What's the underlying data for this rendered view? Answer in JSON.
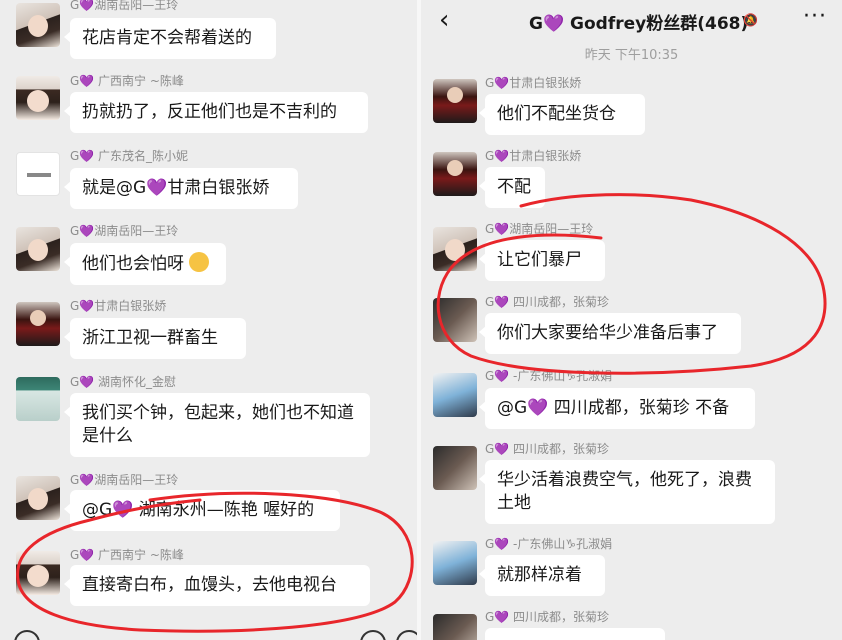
{
  "left": {
    "messages": [
      {
        "sender": "G💜湖南岳阳—王玲",
        "text": "花店肯定不会帮着送的"
      },
      {
        "sender": "G💜 广西南宁 ~陈峰",
        "text": "扔就扔了，反正他们也是不吉利的"
      },
      {
        "sender": "G💜 广东茂名_陈小妮",
        "text": "就是@G💜甘肃白银张娇"
      },
      {
        "sender": "G💜湖南岳阳—王玲",
        "text": "他们也会怕呀"
      },
      {
        "sender": "G💜甘肃白银张娇",
        "text": "浙江卫视一群畜生"
      },
      {
        "sender": "G💜 湖南怀化_金慰",
        "text": "我们买个钟，包起来，她们也不知道是什么"
      },
      {
        "sender": "G💜湖南岳阳—王玲",
        "text": "@G💜 湖南永州—陈艳 喔好的"
      },
      {
        "sender": "G💜 广西南宁 ~陈峰",
        "text": "直接寄白布，血馒头，去他电视台"
      }
    ]
  },
  "right": {
    "header": {
      "back_icon": "chevron-left-icon",
      "title": "G💜 Godfrey粉丝群(468)",
      "mute_icon": "bell-off-icon",
      "more_label": "···"
    },
    "timestamp": "昨天 下午10:35",
    "messages": [
      {
        "sender": "G💜甘肃白银张娇",
        "text": "他们不配坐货仓"
      },
      {
        "sender": "G💜甘肃白银张娇",
        "text": "不配"
      },
      {
        "sender": "G💜湖南岳阳—王玲",
        "text": "让它们暴尸"
      },
      {
        "sender": "G💜 四川成都，张菊珍",
        "text": "你们大家要给华少准备后事了"
      },
      {
        "sender": "G💜 -广东佛山♑孔淑娟",
        "text": "@G💜 四川成都，张菊珍 不备"
      },
      {
        "sender": "G💜 四川成都，张菊珍",
        "text": "华少活着浪费空气，他死了，浪费土地"
      },
      {
        "sender": "G💜 -广东佛山♑孔淑娟",
        "text": "就那样凉着"
      },
      {
        "sender": "G💜 四川成都，张菊珍",
        "text": ""
      }
    ]
  },
  "colors": {
    "background": "#ededed",
    "bubble": "#ffffff",
    "annotation": "#e8262b",
    "heart": "#8a2be2"
  }
}
